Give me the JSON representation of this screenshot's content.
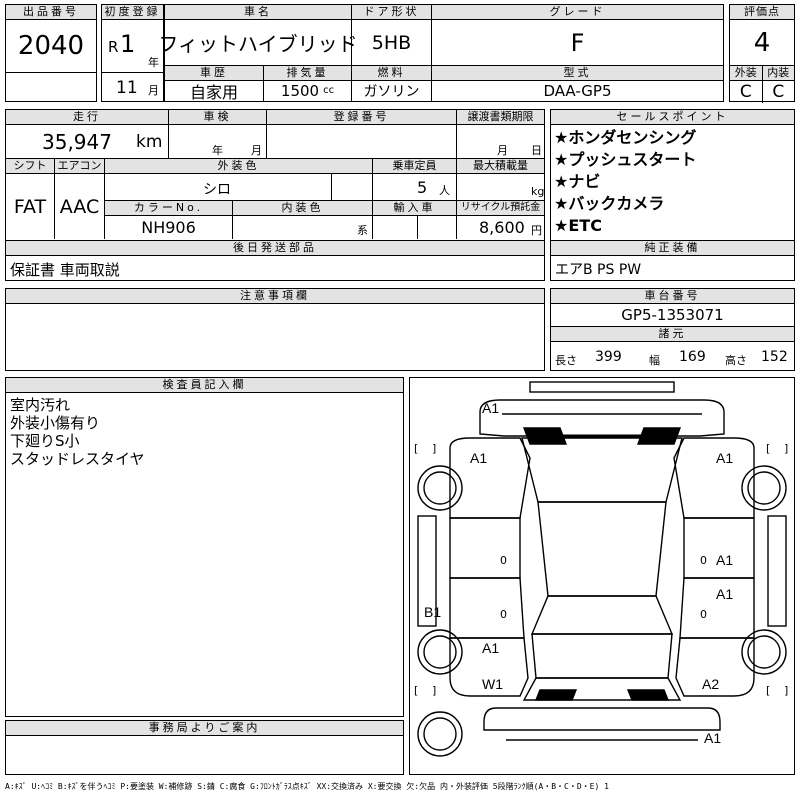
{
  "headers": {
    "lot": "出品番号",
    "first_reg": "初度登録",
    "car_name": "車名",
    "door": "ドア形状",
    "grade": "グレード",
    "score": "評価点",
    "history": "車歴",
    "displacement": "排気量",
    "fuel": "燃料",
    "model": "型式",
    "exterior": "外装",
    "interior": "内装",
    "mileage": "走行",
    "inspection": "車検",
    "reg_no": "登録番号",
    "transfer": "譲渡書類期限",
    "selling": "セールスポイント",
    "shift": "シフト",
    "aircon": "エアコン",
    "ext_color": "外装色",
    "capacity": "乗車定員",
    "max_load": "最大積載量",
    "color_no": "カラーNo.",
    "int_color": "内装色",
    "import": "輸入車",
    "recycle": "リサイクル預託金",
    "later_parts": "後日発送部品",
    "equipment": "純正装備",
    "caution": "注意事項欄",
    "chassis": "車台番号",
    "dimensions": "諸元",
    "inspector": "検査員記入欄",
    "office": "事務局よりご案内"
  },
  "lot_number": "2040",
  "first_reg": {
    "era": "R",
    "year": "1",
    "year_unit": "年",
    "month": "11",
    "month_unit": "月"
  },
  "car_name": "フィットハイブリッド",
  "door": "5HB",
  "grade": "F",
  "score": "4",
  "history": "自家用",
  "displacement": "1500",
  "displacement_unit": "cc",
  "fuel": "ガソリン",
  "model": "DAA-GP5",
  "exterior_grade": "C",
  "interior_grade": "C",
  "mileage": "35,947",
  "mileage_unit": "km",
  "inspection_year_unit": "年",
  "inspection_month_unit": "月",
  "transfer_month_unit": "月",
  "transfer_day_unit": "日",
  "shift": "FAT",
  "aircon": "AAC",
  "ext_color": "シロ",
  "capacity": "5",
  "capacity_unit": "人",
  "max_load_unit": "kg",
  "color_no": "NH906",
  "int_color_unit": "系",
  "recycle": "8,600",
  "recycle_unit": "円",
  "selling_points": [
    "★ホンダセンシング",
    "★プッシュスタート",
    "★ナビ",
    "★バックカメラ",
    "★ETC"
  ],
  "later_parts": "保証書 車両取説",
  "equipment": "エアB PS PW",
  "chassis": "GP5-1353071",
  "dims": {
    "length_label": "長さ",
    "length": "399",
    "width_label": "幅",
    "width": "169",
    "height_label": "高さ",
    "height": "152"
  },
  "inspector_notes": [
    "室内汚れ",
    "外装小傷有り",
    "下廻りS小",
    "スタッドレスタイヤ"
  ],
  "diagram_marks": {
    "top": "A1",
    "front_left": "A1",
    "front_right": "A1",
    "right_upper": "A1",
    "right_lower": "A1",
    "left_rear": "B1",
    "left_lower": "A1",
    "rear_left": "W1",
    "rear_right": "A2",
    "bottom": "A1"
  },
  "legend": "A:ｷｽﾞ U:ﾍｺﾐ B:ｷｽﾞを伴うﾍｺﾐ P:要塗装 W:補修跡 S:錆 C:腐食 G:ﾌﾛﾝﾄｶﾞﾗｽ点ｷｽﾞ XX:交換済み X:要交換 欠:欠品 内・外装評価 5段階ﾗﾝｸ順(A・B・C・D・E) 1"
}
